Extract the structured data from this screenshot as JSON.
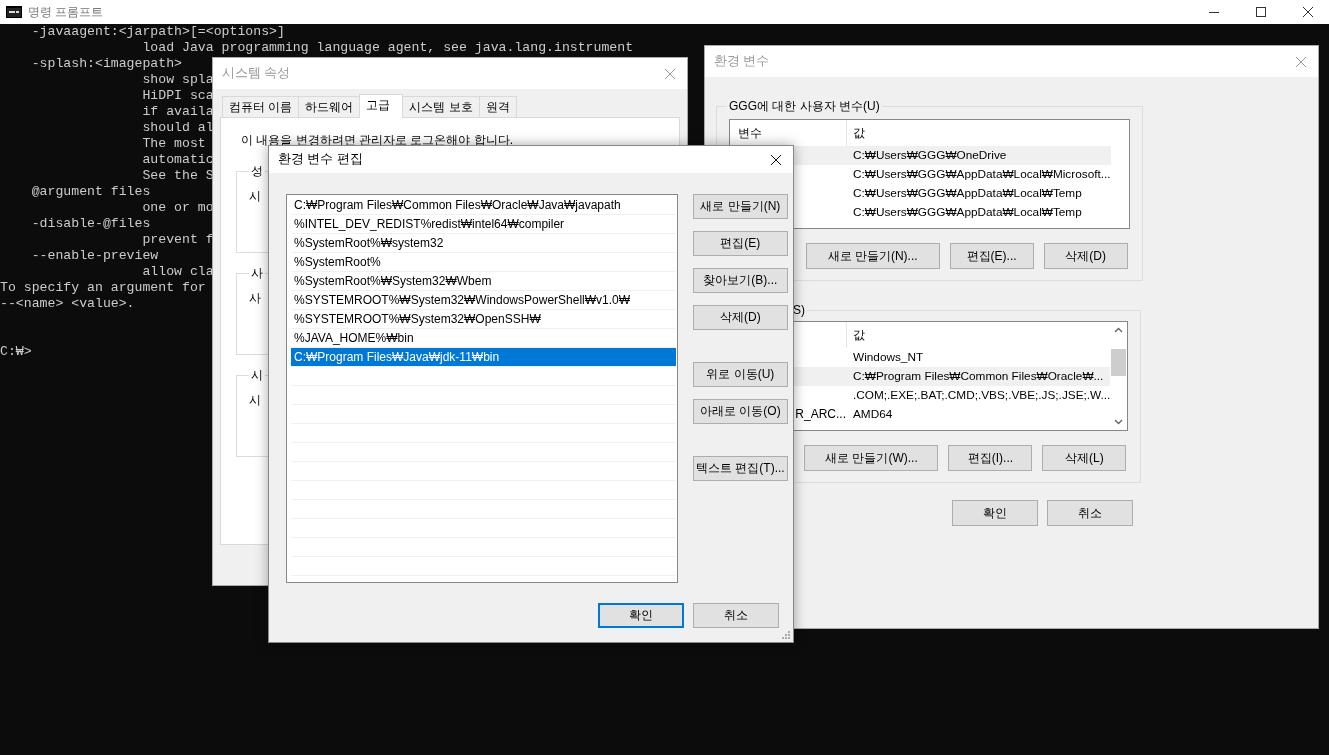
{
  "console": {
    "title": "명령 프롬프트",
    "lines": [
      "    -javaagent:<jarpath>[=<options>]",
      "                  load Java programming language agent, see java.lang.instrument",
      "    -splash:<imagepath>",
      "                  show spla",
      "                  HiDPI sca",
      "                  if availa",
      "                  should al",
      "                  The most",
      "                  automatic",
      "                  See the S",
      "    @argument files",
      "                  one or mo",
      "    -disable-@files",
      "                  prevent f",
      "    --enable-preview",
      "                  allow cla",
      "To specify an argument for",
      "--<name> <value>."
    ],
    "prompt": "C:₩>"
  },
  "system_properties": {
    "title": "시스템 속성",
    "tabs": [
      {
        "label": "컴퓨터 이름",
        "selected": false
      },
      {
        "label": "하드웨어",
        "selected": false
      },
      {
        "label": "고급",
        "selected": true
      },
      {
        "label": "시스템 보호",
        "selected": false
      },
      {
        "label": "원격",
        "selected": false
      }
    ],
    "notice": "이 내용을 변경하려면 관리자로 로그온해야 합니다.",
    "groups": [
      {
        "label": "성",
        "text": "시"
      },
      {
        "label": "사",
        "text": "사"
      },
      {
        "label": "시",
        "text": "시"
      }
    ]
  },
  "environment_variables": {
    "title": "환경 변수",
    "user_variables": {
      "label": "GGG에 대한 사용자 변수(U)",
      "columns": [
        "변수",
        "값"
      ],
      "rows": [
        {
          "value": "C:₩Users₩GGG₩OneDrive",
          "selected": true
        },
        {
          "value": "C:₩Users₩GGG₩AppData₩Local₩Microsoft...",
          "selected": false
        },
        {
          "value": "C:₩Users₩GGG₩AppData₩Local₩Temp",
          "selected": false
        },
        {
          "value": "C:₩Users₩GGG₩AppData₩Local₩Temp",
          "selected": false
        }
      ],
      "buttons": [
        "새로 만들기(N)...",
        "편집(E)...",
        "삭제(D)"
      ]
    },
    "system_variables": {
      "label": "S)",
      "columns": [
        "값"
      ],
      "rows": [
        {
          "value": "Windows_NT",
          "selected": false
        },
        {
          "value": "C:₩Program Files₩Common Files₩Oracle₩...",
          "selected": true
        },
        {
          "value": ".COM;.EXE;.BAT;.CMD;.VBS;.VBE;.JS;.JSE;.W...",
          "selected": false
        },
        {
          "name": "R_ARC...",
          "value": "AMD64",
          "selected": false
        }
      ],
      "buttons": [
        "새로 만들기(W)...",
        "편집(I)...",
        "삭제(L)"
      ]
    },
    "ok": "확인",
    "cancel": "취소"
  },
  "edit_dialog": {
    "title": "환경 변수 편집",
    "entries": [
      {
        "text": "C:₩Program Files₩Common Files₩Oracle₩Java₩javapath",
        "selected": false
      },
      {
        "text": "%INTEL_DEV_REDIST%redist₩intel64₩compiler",
        "selected": false
      },
      {
        "text": "%SystemRoot%₩system32",
        "selected": false
      },
      {
        "text": "%SystemRoot%",
        "selected": false
      },
      {
        "text": "%SystemRoot%₩System32₩Wbem",
        "selected": false
      },
      {
        "text": "%SYSTEMROOT%₩System32₩WindowsPowerShell₩v1.0₩",
        "selected": false
      },
      {
        "text": "%SYSTEMROOT%₩System32₩OpenSSH₩",
        "selected": false
      },
      {
        "text": "%JAVA_HOME%₩bin",
        "selected": false
      },
      {
        "text": "C:₩Program Files₩Java₩jdk-11₩bin",
        "selected": true
      }
    ],
    "button_groups": [
      [
        "새로 만들기(N)",
        "편집(E)",
        "찾아보기(B)...",
        "삭제(D)"
      ],
      [
        "위로 이동(U)",
        "아래로 이동(O)"
      ],
      [
        "텍스트 편집(T)..."
      ]
    ],
    "ok": "확인",
    "cancel": "취소"
  }
}
